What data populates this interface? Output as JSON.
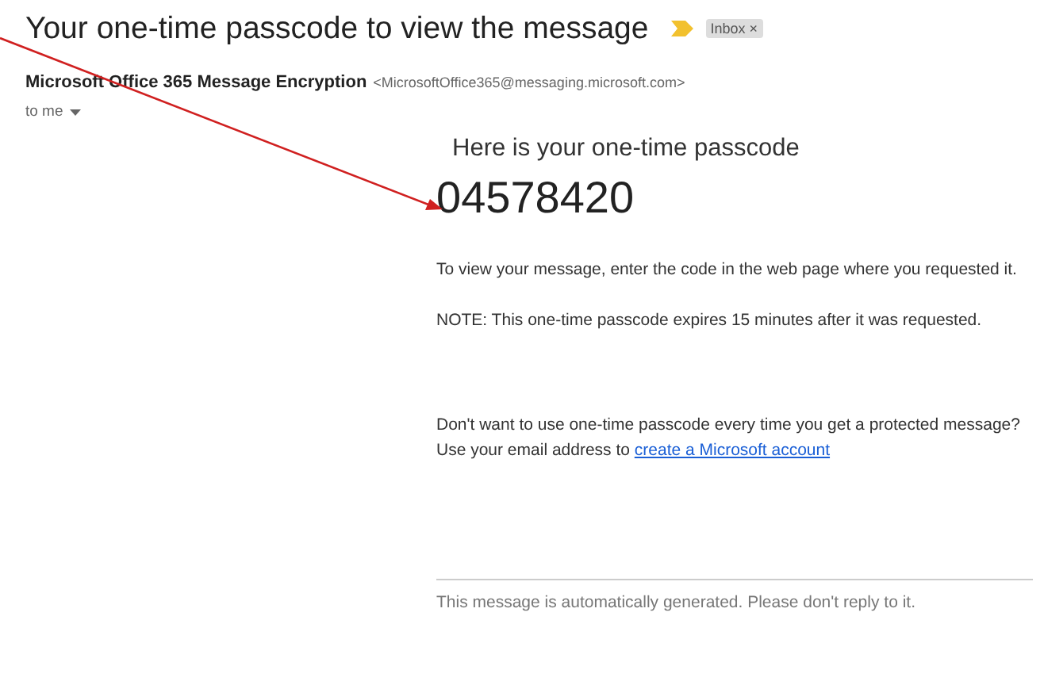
{
  "subject": "Your one-time passcode to view the message",
  "label": {
    "text": "Inbox",
    "close": "×"
  },
  "sender": {
    "name": "Microsoft Office 365 Message Encryption",
    "address": "<MicrosoftOffice365@messaging.microsoft.com>",
    "recipient": "to me"
  },
  "body": {
    "heading": "Here is your one-time passcode",
    "code": "04578420",
    "instructions": "To view your message, enter the code in the web page where you requested it.",
    "note": "NOTE: This one-time passcode expires 15 minutes after it was requested.",
    "promo": "Don't want to use one-time passcode every time you get a protected message? Use your email address to",
    "promo_link": "create a Microsoft account",
    "footer": "This message is automatically generated. Please don't reply to it."
  }
}
